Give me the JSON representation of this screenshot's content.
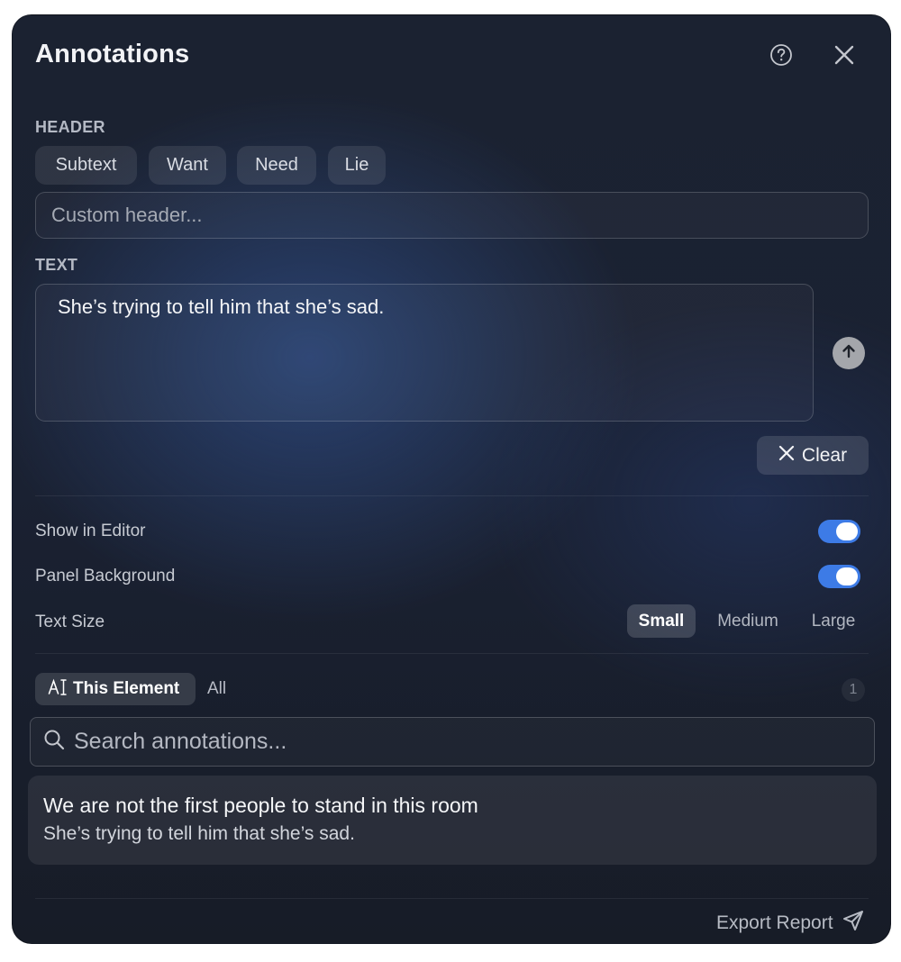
{
  "header": {
    "title": "Annotations",
    "help_icon": "question-circle-icon",
    "close_icon": "close-icon"
  },
  "header_section": {
    "label": "HEADER",
    "presets": [
      "Subtext",
      "Want",
      "Need",
      "Lie"
    ],
    "custom_input": {
      "placeholder": "Custom header...",
      "value": ""
    }
  },
  "text_section": {
    "label": "TEXT",
    "value": "She’s trying to tell him that she’s sad.",
    "submit_icon": "arrow-up-icon",
    "clear_label": "Clear"
  },
  "settings": {
    "show_in_editor": {
      "label": "Show in Editor",
      "on": true
    },
    "panel_background": {
      "label": "Panel Background",
      "on": true
    },
    "text_size": {
      "label": "Text Size",
      "options": [
        "Small",
        "Medium",
        "Large"
      ],
      "selected": "Small"
    }
  },
  "filter": {
    "this_element": "This Element",
    "all": "All",
    "count": "1"
  },
  "search": {
    "placeholder": "Search annotations..."
  },
  "results": [
    {
      "title": "We are not the first people to stand in this room",
      "text": "She’s trying to tell him that she’s sad."
    }
  ],
  "footer": {
    "export_label": "Export Report"
  },
  "colors": {
    "accent": "#3d7be6",
    "background": "#1b2231"
  }
}
